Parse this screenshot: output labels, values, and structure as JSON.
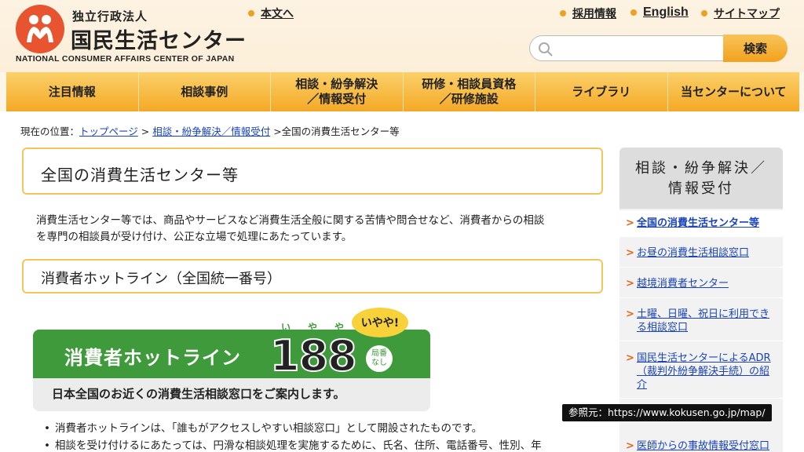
{
  "header": {
    "org_type": "独立行政法人",
    "org_name": "国民生活センター",
    "org_name_en": "NATIONAL CONSUMER AFFAIRS CENTER OF JAPAN",
    "skip_link": "本文へ",
    "links": [
      "採用情報",
      "English",
      "サイトマップ"
    ],
    "search": {
      "placeholder": "",
      "button": "検索"
    }
  },
  "nav": {
    "items": [
      {
        "label": "注目情報"
      },
      {
        "label": "相談事例"
      },
      {
        "label": "相談・紛争解決\n／情報受付"
      },
      {
        "label": "研修・相談員資格\n／研修施設"
      },
      {
        "label": "ライブラリ"
      },
      {
        "label": "当センターについて"
      }
    ]
  },
  "breadcrumb": {
    "prefix": "現在の位置：",
    "items": [
      "トップページ",
      "相談・紛争解決／情報受付"
    ],
    "current": "全国の消費生活センター等"
  },
  "main": {
    "title": "全国の消費生活センター等",
    "intro_line1": "消費生活センター等では、商品やサービスなど消費生活全般に関する苦情や問合せなど、消費者からの相談",
    "intro_line2": "を専門の相談員が受け付け、公正な立場で処理にあたっています。",
    "subtitle": "消費者ホットライン（全国統一番号）",
    "banner": {
      "title": "消費者ホットライン",
      "number": "188",
      "ruby": [
        "い",
        "や",
        "や"
      ],
      "bubble": "いやや!",
      "badge_line1": "局番",
      "badge_line2": "なし",
      "tagline": "日本全国のお近くの消費生活相談窓口をご案内します。"
    },
    "bullets": [
      "消費者ホットラインは、「誰もがアクセスしやすい相談窓口」として開設されたものです。",
      "相談を受け付けるにあたっては、円滑な相談処理を実施するために、氏名、住所、電話番号、性別、年"
    ]
  },
  "sidebar": {
    "heading_line1": "相談・紛争解決／",
    "heading_line2": "情報受付",
    "items": [
      "全国の消費生活センター等",
      "お昼の消費生活相談窓口",
      "越境消費者センター",
      "土曜、日曜、祝日に利用できる相談窓口",
      "国民生活センターによるADR（裁判外紛争解決手続）の紹介",
      "医師からの事故情報受付窓口"
    ]
  },
  "tooltip": "参照元：https://www.kokusen.go.jp/map/",
  "colors": {
    "accent": "#f5ae2c",
    "link": "#1a44b8",
    "logo": "#e8542f",
    "hotline_green": "#3e9a3a"
  }
}
